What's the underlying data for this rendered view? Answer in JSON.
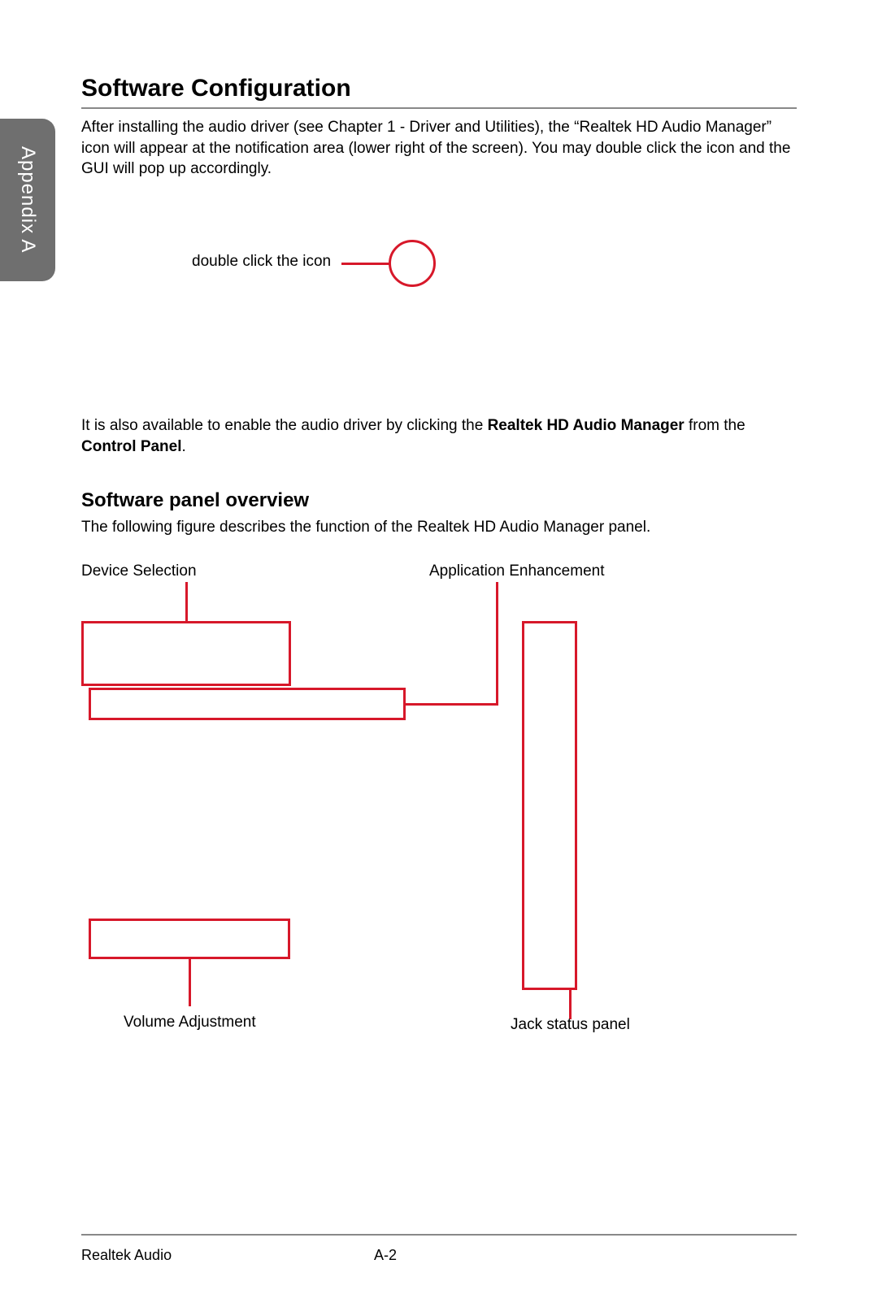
{
  "sidebar": {
    "label": "Appendix A"
  },
  "heading1": "Software Configuration",
  "intro": "After installing the audio driver (see Chapter 1 - Driver and Utilities), the “Realtek HD Audio Manager” icon will appear at the notification area (lower right of the screen). You may double click the icon and the GUI will pop up accordingly.",
  "iconLabel": "double click the icon",
  "para2_pre": "It is also available to enable the audio driver by clicking the ",
  "para2_bold1": "Realtek HD Audio Manager",
  "para2_mid": " from the ",
  "para2_bold2": "Control Panel",
  "para2_end": ".",
  "heading2": "Software panel overview",
  "para3": "The following figure describes the function of the Realtek HD Audio Manager panel.",
  "diagram": {
    "deviceSelection": "Device Selection",
    "appEnhancement": "Application Enhancement",
    "volumeAdjustment": "Volume Adjustment",
    "jackStatus": "Jack status panel"
  },
  "footer": {
    "left": "Realtek Audio",
    "page": "A-2"
  }
}
